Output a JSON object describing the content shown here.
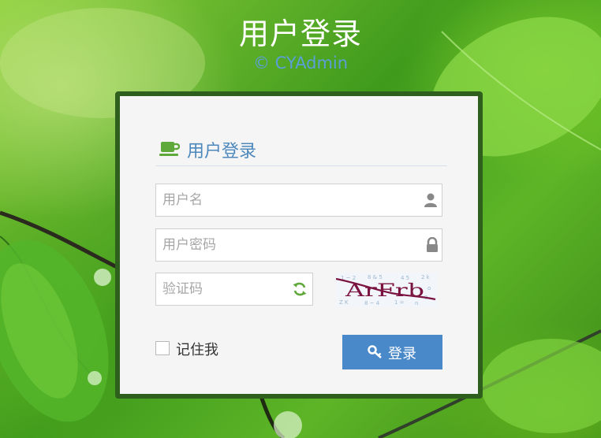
{
  "header": {
    "title": "用户登录",
    "copyright": "© CYAdmin"
  },
  "login_box": {
    "heading": "用户登录",
    "heading_icon": "coffee-cup-icon",
    "username": {
      "placeholder": "用户名",
      "value": "",
      "icon": "user-icon"
    },
    "password": {
      "placeholder": "用户密码",
      "value": "",
      "icon": "lock-icon"
    },
    "captcha": {
      "placeholder": "验证码",
      "value": "",
      "icon": "refresh-icon",
      "image_text": "ArFrb"
    },
    "remember_label": "记住我",
    "remember_checked": false,
    "submit_label": "登录",
    "submit_icon": "key-icon"
  },
  "colors": {
    "title_text": "#ffffff",
    "copyright_text": "#5a9fd6",
    "box_border": "#2e5f1c",
    "heading_text": "#4d88bd",
    "button_bg": "#4a89c9",
    "refresh_icon": "#5fa83a"
  }
}
